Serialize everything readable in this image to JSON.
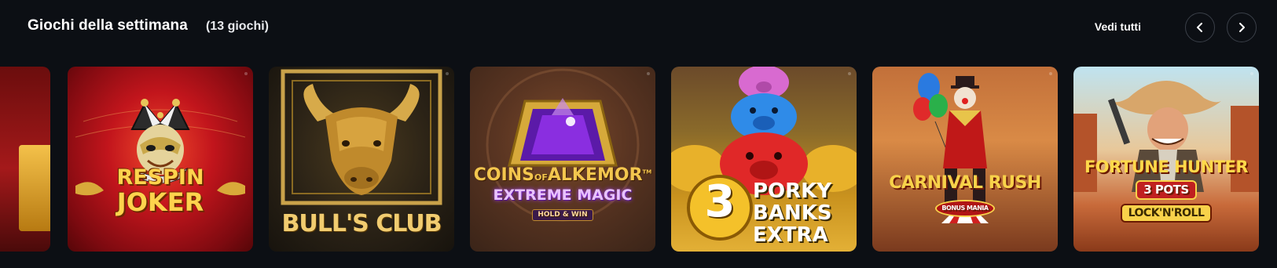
{
  "section": {
    "title": "Giochi della settimana",
    "count": "(13 giochi)",
    "see_all": "Vedi tutti"
  },
  "games": [
    {
      "id": "partial",
      "name": ""
    },
    {
      "id": "respin-joker",
      "name": "Respin Joker",
      "logo_line1": "RESPIN",
      "logo_line2": "JOKER"
    },
    {
      "id": "bulls-club",
      "name": "Bull's Club",
      "logo_line1": "BULL'S CLUB"
    },
    {
      "id": "coins-alkemor",
      "name": "Coins of Alkemor Extreme Magic",
      "logo_line1": "COINS",
      "logo_of": "of",
      "logo_line1b": "ALKEMOR",
      "logo_tm": "TM",
      "logo_line2": "EXTREME MAGIC",
      "logo_line3": "HOLD & WIN"
    },
    {
      "id": "porky-banks",
      "name": "3 Porky Banks Extra",
      "logo_num": "3",
      "logo_line1": "PORKY",
      "logo_line2": "BANKS",
      "logo_line3": "EXTRA"
    },
    {
      "id": "carnival-rush",
      "name": "Carnival Rush",
      "logo_line1": "CARNIVAL",
      "logo_line1b": "RUSH",
      "logo_line2": "BONUS MANIA"
    },
    {
      "id": "fortune-hunter",
      "name": "Fortune Hunter 3 Pots Lock n Roll",
      "logo_line1": "FORTUNE HUNTER",
      "logo_line2": "3 POTS",
      "logo_line3": "LOCK'N'ROLL"
    }
  ],
  "icons": {
    "prev": "chevron-left-icon",
    "next": "chevron-right-icon"
  },
  "colors": {
    "background": "#0c0f14",
    "nav_border": "#3a3f48"
  }
}
